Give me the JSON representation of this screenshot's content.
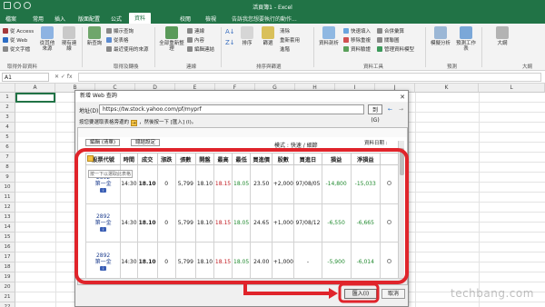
{
  "window": {
    "title": "活頁簿1 - Excel"
  },
  "tabs": [
    {
      "label": "檔案"
    },
    {
      "label": "常用"
    },
    {
      "label": "插入"
    },
    {
      "label": "版面配置"
    },
    {
      "label": "公式"
    },
    {
      "label": "資料"
    },
    {
      "label": "校閱"
    },
    {
      "label": "檢視"
    }
  ],
  "tell_me": "告訴我您想要執行的動作...",
  "ribbon": {
    "get_external": {
      "items": [
        "從 Access",
        "從 Web",
        "從文字檔"
      ],
      "other_label": "從其他來源",
      "existing_label": "現有連線",
      "group": "取得外部資料"
    },
    "new_query": {
      "label": "新查詢",
      "items": [
        "顯示查詢",
        "從表格",
        "最近使用的來源"
      ],
      "group": "取得及轉換"
    },
    "refresh": {
      "label": "全部重新整理",
      "items": [
        "連線",
        "內容",
        "編輯連結"
      ],
      "group": "連線"
    },
    "sort": {
      "items": [
        "排序",
        "篩選"
      ],
      "extra": [
        "清除",
        "重新套用",
        "進階"
      ],
      "group": "排序與篩選"
    },
    "tools": {
      "items": [
        "資料剖析",
        "快速填入",
        "移除重複",
        "資料驗證"
      ],
      "more": [
        "合併彙算",
        "關聯圖",
        "管理資料模型"
      ],
      "group": "資料工具"
    },
    "forecast": {
      "items": [
        "模擬分析",
        "預測工作表"
      ],
      "group": "預測"
    },
    "outline": {
      "items": [
        "大綱"
      ],
      "group": "大綱"
    }
  },
  "formula_bar": {
    "namebox": "A1"
  },
  "columns": [
    "A",
    "B",
    "C",
    "D",
    "E",
    "F",
    "G",
    "H",
    "I",
    "J",
    "K",
    "L"
  ],
  "rows": [
    "1",
    "2",
    "3",
    "4",
    "5",
    "6",
    "7",
    "8",
    "9",
    "10",
    "11",
    "12",
    "13",
    "14",
    "15",
    "16",
    "17",
    "18",
    "19",
    "20",
    "21",
    "22"
  ],
  "dialog": {
    "title": "新增 Web 查詢",
    "address_label": "地址(D):",
    "address": "https://tw.stock.yahoo.com/pf/myprf",
    "go_label": "到(G)",
    "hint_prefix": "按您要選取表格旁邊的",
    "hint_suffix": "，然後按一下 [匯入] (I)。",
    "page": {
      "tabs": [
        "編輯 (清單)",
        "總結設定"
      ],
      "mode": "模式 : 快速 / 細節",
      "date_label": "資料日期 :"
    },
    "tooltip": "按一下以選取此表格",
    "table": {
      "headers": [
        "股票代號",
        "時間",
        "成交",
        "漲跌",
        "張數",
        "開盤",
        "最高",
        "最低",
        "買進價",
        "股數",
        "買進日",
        "損益",
        "淨損益"
      ],
      "rows": [
        {
          "code": "2892",
          "name": "第一金",
          "time": "14:30",
          "price": "18.10",
          "chg": "0",
          "vol": "5,799",
          "open": "18.10",
          "high": "18.15",
          "low": "18.05",
          "buy": "23.50",
          "qty": "+2,000",
          "date": "97/08/05",
          "pl": "-14,800",
          "net": "-15,033"
        },
        {
          "code": "2892",
          "name": "第一金",
          "time": "14:30",
          "price": "18.10",
          "chg": "0",
          "vol": "5,799",
          "open": "18.10",
          "high": "18.15",
          "low": "18.05",
          "buy": "24.65",
          "qty": "+1,000",
          "date": "97/08/12",
          "pl": "-6,550",
          "net": "-6,665"
        },
        {
          "code": "2892",
          "name": "第一金",
          "time": "14:30",
          "price": "18.10",
          "chg": "0",
          "vol": "5,799",
          "open": "18.10",
          "high": "18.15",
          "low": "18.05",
          "buy": "24.00",
          "qty": "+1,000",
          "date": "-",
          "pl": "-5,900",
          "net": "-6,014"
        }
      ]
    },
    "import_label": "匯入(I)",
    "cancel_label": "取消"
  },
  "watermark": "techbang.com",
  "colors": {
    "excel_green": "#217346",
    "highlight_red": "#e0242b"
  }
}
